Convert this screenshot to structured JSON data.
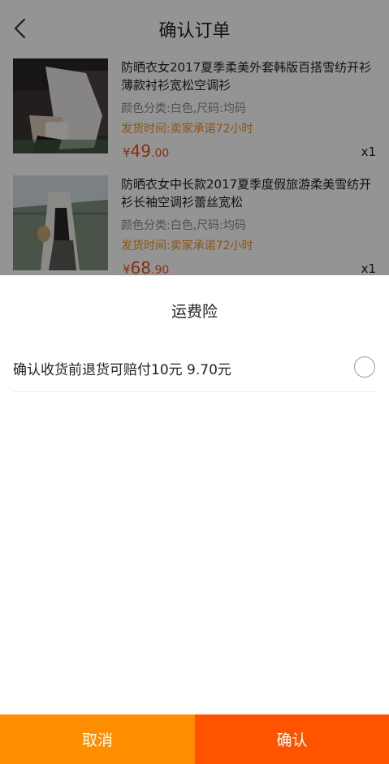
{
  "header": {
    "title": "确认订单",
    "back_icon": "chevron-left-icon"
  },
  "products": [
    {
      "title": "防晒衣女2017夏季柔美外套韩版百搭雪纺开衫薄款衬衫宽松空调衫",
      "spec": "颜色分类:白色,尺码:均码",
      "shipping": "发货时间:卖家承诺72小时",
      "price_symbol": "¥",
      "price_int": "49",
      "price_dec": ".00",
      "qty": "x1"
    },
    {
      "title": "防晒衣女中长款2017夏季度假旅游柔美雪纺开衫长袖空调衫蕾丝宽松",
      "spec": "颜色分类:白色,尺码:均码",
      "shipping": "发货时间:卖家承诺72小时",
      "price_symbol": "¥",
      "price_int": "68",
      "price_dec": ".90",
      "qty": "x1"
    }
  ],
  "sheet": {
    "title": "运费险",
    "option_label": "确认收货前退货可赔付10元 9.70元",
    "option_selected": false,
    "cancel_label": "取消",
    "confirm_label": "确认"
  },
  "colors": {
    "price": "#f04e1a",
    "shipping": "#f0921f",
    "cancel_bg": "#ff8d00",
    "confirm_bg": "#ff5300"
  }
}
